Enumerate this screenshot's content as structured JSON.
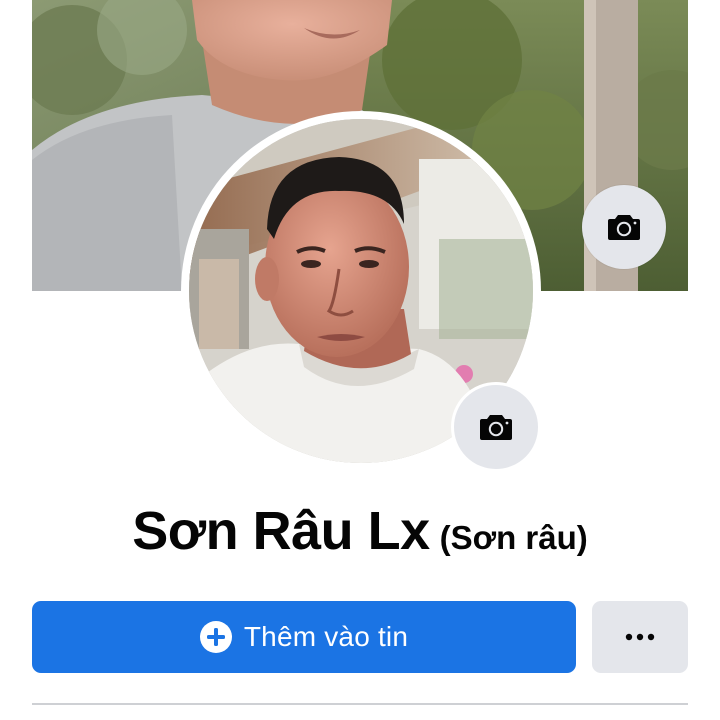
{
  "profile": {
    "name": "Sơn Râu Lx",
    "alternate_name": "(Sơn râu)"
  },
  "cover": {
    "camera_button_icon": "camera-icon"
  },
  "avatar": {
    "camera_button_icon": "camera-icon"
  },
  "actions": {
    "add_story_label": "Thêm vào tin",
    "add_story_icon": "plus-circle-icon",
    "more_icon": "more-dots-icon"
  },
  "colors": {
    "primary_button": "#1b74e4",
    "secondary_button": "#e4e6eb",
    "text": "#050505"
  }
}
